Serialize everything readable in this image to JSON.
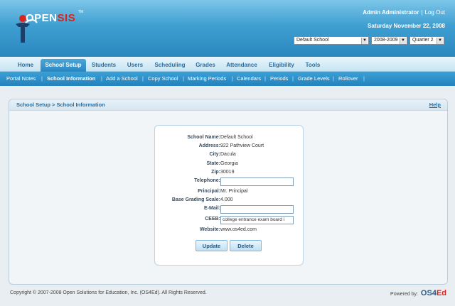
{
  "header": {
    "logo_text_open": "OPEN",
    "logo_text_sis": "SIS",
    "logo_tm": "TM",
    "user_name": "Admin Administrator",
    "user_sep": "|",
    "logout_label": "Log Out",
    "date": "Saturday November 22, 2008",
    "school_select": "Default School",
    "year_select": "2008-2009",
    "quarter_select": "Quarter 2"
  },
  "tabs": [
    "Home",
    "School Setup",
    "Students",
    "Users",
    "Scheduling",
    "Grades",
    "Attendance",
    "Eligibility",
    "Tools"
  ],
  "subnav": [
    "Portal Notes",
    "School Information",
    "Add a School",
    "Copy School",
    "Marking Periods",
    "Calendars",
    "Periods",
    "Grade Levels",
    "Rollover"
  ],
  "subnav_sep": "|",
  "panel": {
    "breadcrumb": "School Setup > School Information",
    "help": "Help"
  },
  "form": {
    "school_name": {
      "label": "School Name:",
      "value": "Default School"
    },
    "address": {
      "label": "Address:",
      "value": "922 Pathview Court"
    },
    "city": {
      "label": "City:",
      "value": "Dacula"
    },
    "state": {
      "label": "State:",
      "value": "Georgia"
    },
    "zip": {
      "label": "Zip:",
      "value": "30019"
    },
    "telephone": {
      "label": "Telephone:",
      "value": ""
    },
    "principal": {
      "label": "Principal:",
      "value": "Mr. Principal"
    },
    "grading": {
      "label": "Base Grading Scale:",
      "value": "4.000"
    },
    "email": {
      "label": "E-Mail:",
      "value": ""
    },
    "ceeb": {
      "label": "CEEB:",
      "value": "college entrance exam board i"
    },
    "website": {
      "label": "Website:",
      "value": "www.os4ed.com"
    },
    "update_label": "Update",
    "delete_label": "Delete"
  },
  "footer": {
    "copyright": "Copyright © 2007-2008 Open Solutions for Education, Inc. (OS4Ed). All Rights Reserved.",
    "powered_by": "Powered by:",
    "brand_os4": "OS4",
    "brand_ed": "Ed"
  },
  "colors": {
    "header_blue": "#2b87bf",
    "accent_red": "#d9241c",
    "link_blue": "#2a6c9e"
  }
}
